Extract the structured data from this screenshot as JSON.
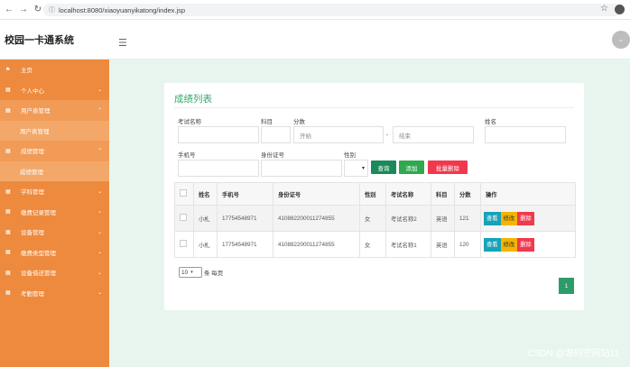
{
  "browser": {
    "url": "localhost:8080/xiaoyuanyikatong/index.jsp"
  },
  "header": {
    "app_title": "校园一卡通系统"
  },
  "sidebar": {
    "items": [
      {
        "label": "主页"
      },
      {
        "label": "个人中心"
      },
      {
        "label": "用户表管理"
      },
      {
        "label": "用户表管理"
      },
      {
        "label": "成绩管理"
      },
      {
        "label": "成绩管理"
      },
      {
        "label": "学科管理"
      },
      {
        "label": "缴费记录管理"
      },
      {
        "label": "设备管理"
      },
      {
        "label": "缴费类型管理"
      },
      {
        "label": "设备借还管理"
      },
      {
        "label": "考勤管理"
      }
    ]
  },
  "main": {
    "title": "成绩列表",
    "filters": {
      "exam_name_label": "考试名称",
      "subject_label": "科目",
      "score_label": "分数",
      "score_start_placeholder": "开始",
      "score_sep": "-",
      "score_end_placeholder": "结束",
      "name_label": "姓名",
      "phone_label": "手机号",
      "idcard_label": "身份证号",
      "gender_label": "性别"
    },
    "buttons": {
      "query": "查询",
      "add": "添加",
      "batch_delete": "批量删除"
    },
    "table": {
      "columns": [
        "姓名",
        "手机号",
        "身份证号",
        "性别",
        "考试名称",
        "科目",
        "分数",
        "操作"
      ],
      "rows": [
        [
          "小札",
          "17754548971",
          "410882200011274855",
          "女",
          "考试名称2",
          "英语",
          "121"
        ],
        [
          "小札",
          "17754548971",
          "410882200011274855",
          "女",
          "考试名称1",
          "英语",
          "120"
        ]
      ],
      "actions": {
        "view": "查看",
        "edit": "修改",
        "delete": "删除"
      }
    },
    "pagination": {
      "page_size": "10",
      "page_size_suffix": "条 每页",
      "current_page": "1"
    }
  },
  "watermark": "CSDN @源码空间站11"
}
